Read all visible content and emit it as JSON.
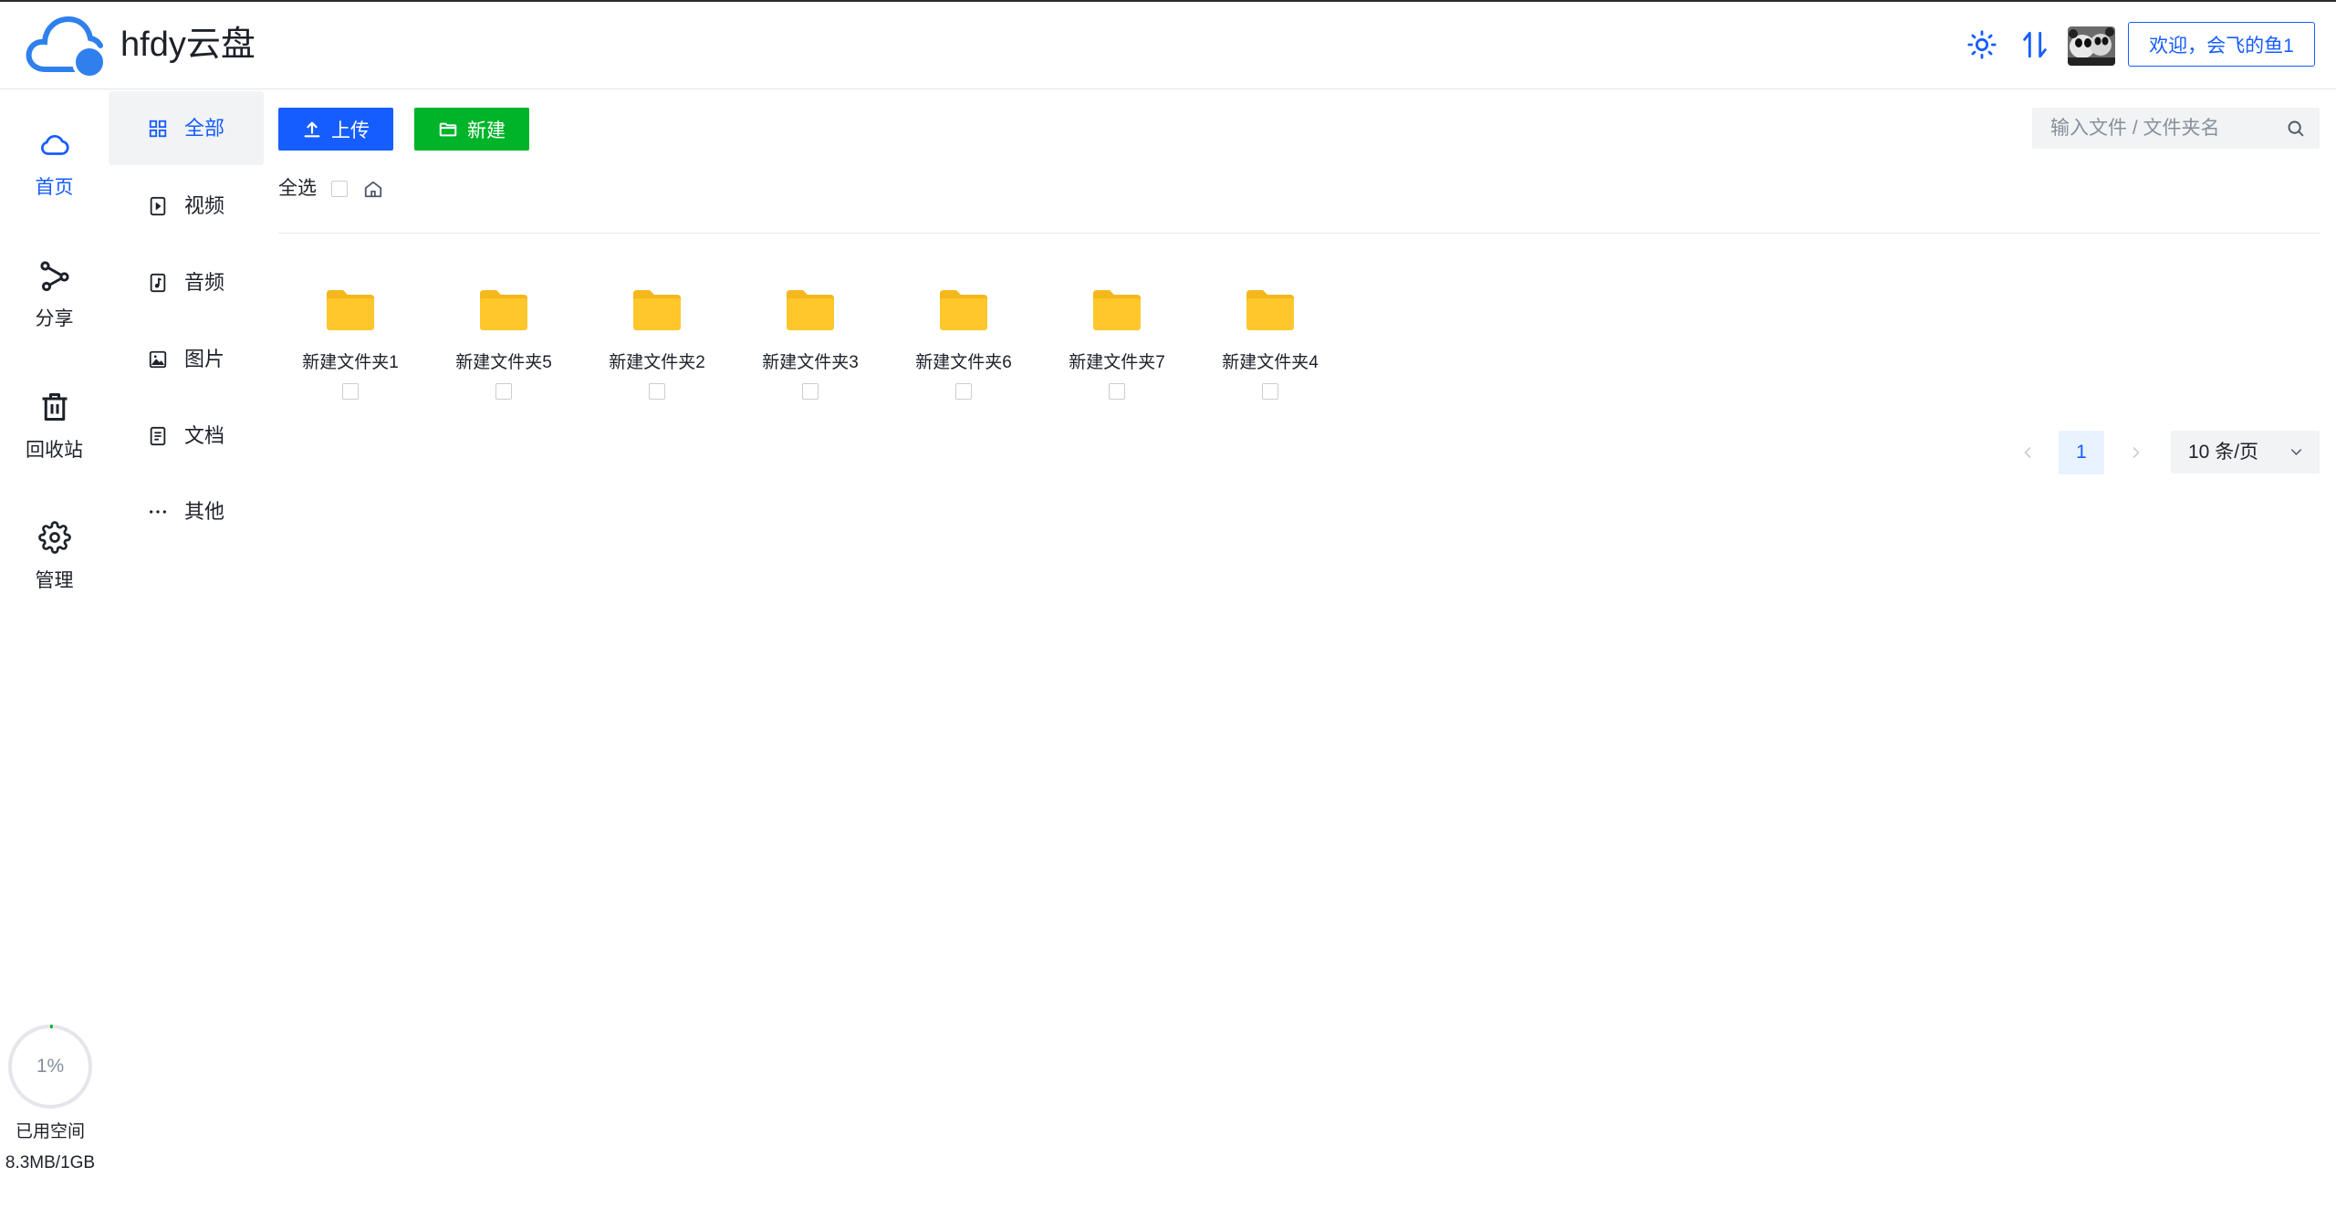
{
  "app": {
    "title": "hfdy云盘",
    "logo_icon": "cloud-logo-icon"
  },
  "colors": {
    "primary": "#165dff",
    "success": "#00b42a",
    "folder": "#ffc72c",
    "active_bg": "#f2f3f5",
    "progress": "#00b42a"
  },
  "header": {
    "theme_icon": "sun-icon",
    "transfer_icon": "sort-arrows-icon",
    "avatar": "panda-avatar",
    "welcome_button": "欢迎，会飞的鱼1"
  },
  "rail": {
    "items": [
      {
        "label": "首页",
        "icon": "cloud-icon",
        "active": true
      },
      {
        "label": "分享",
        "icon": "share-icon",
        "active": false
      },
      {
        "label": "回收站",
        "icon": "trash-icon",
        "active": false
      },
      {
        "label": "管理",
        "icon": "gear-icon",
        "active": false
      }
    ]
  },
  "categories": {
    "items": [
      {
        "label": "全部",
        "icon": "grid-icon",
        "active": true
      },
      {
        "label": "视频",
        "icon": "video-file-icon",
        "active": false
      },
      {
        "label": "音频",
        "icon": "audio-file-icon",
        "active": false
      },
      {
        "label": "图片",
        "icon": "image-icon",
        "active": false
      },
      {
        "label": "文档",
        "icon": "document-icon",
        "active": false
      },
      {
        "label": "其他",
        "icon": "more-icon",
        "active": false
      }
    ]
  },
  "toolbar": {
    "upload_label": "上传",
    "upload_icon": "upload-icon",
    "new_label": "新建",
    "new_icon": "folder-icon"
  },
  "search": {
    "placeholder": "输入文件 / 文件夹名",
    "icon": "search-icon"
  },
  "selection": {
    "select_all_label": "全选",
    "breadcrumb_icon": "home-icon"
  },
  "files": [
    {
      "name": "新建文件夹1",
      "icon": "folder-icon"
    },
    {
      "name": "新建文件夹5",
      "icon": "folder-icon"
    },
    {
      "name": "新建文件夹2",
      "icon": "folder-icon"
    },
    {
      "name": "新建文件夹3",
      "icon": "folder-icon"
    },
    {
      "name": "新建文件夹6",
      "icon": "folder-icon"
    },
    {
      "name": "新建文件夹7",
      "icon": "folder-icon"
    },
    {
      "name": "新建文件夹4",
      "icon": "folder-icon"
    }
  ],
  "pagination": {
    "current_page": "1",
    "page_size": "10 条/页"
  },
  "storage": {
    "percent_label": "1%",
    "used_percent": 1,
    "label": "已用空间",
    "usage": "8.3MB/1GB"
  }
}
